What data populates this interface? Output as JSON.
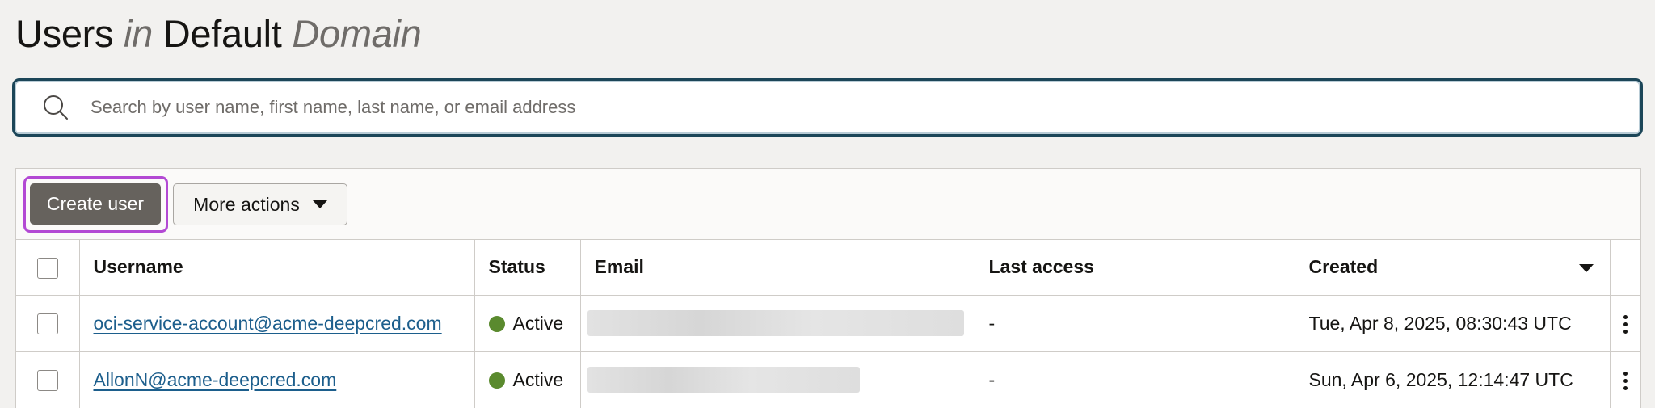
{
  "header": {
    "title_part1": "Users",
    "title_part2": "in",
    "title_part3": "Default",
    "title_part4": "Domain"
  },
  "search": {
    "placeholder": "Search by user name, first name, last name, or email address",
    "value": ""
  },
  "toolbar": {
    "create_label": "Create user",
    "more_label": "More actions"
  },
  "table": {
    "columns": {
      "username": "Username",
      "status": "Status",
      "email": "Email",
      "last_access": "Last access",
      "created": "Created"
    },
    "sort": "Created, descending",
    "rows": [
      {
        "username": "oci-service-account@acme-deepcred.com",
        "status": "Active",
        "email": "",
        "last_access": "-",
        "created": "Tue, Apr 8, 2025, 08:30:43 UTC"
      },
      {
        "username": "AllonN@acme-deepcred.com",
        "status": "Active",
        "email": "",
        "last_access": "-",
        "created": "Sun, Apr 6, 2025, 12:14:47 UTC"
      }
    ]
  },
  "colors": {
    "primary_button": "#66625d",
    "focus_ring": "#b349d4",
    "search_border": "#1c4658",
    "link": "#1c5e8c",
    "status_active": "#5a8a2e"
  },
  "icons": {
    "search": "search-icon",
    "dropdown": "caret-down-icon",
    "sort": "sort-descending-icon",
    "row_actions": "kebab-menu-icon"
  }
}
